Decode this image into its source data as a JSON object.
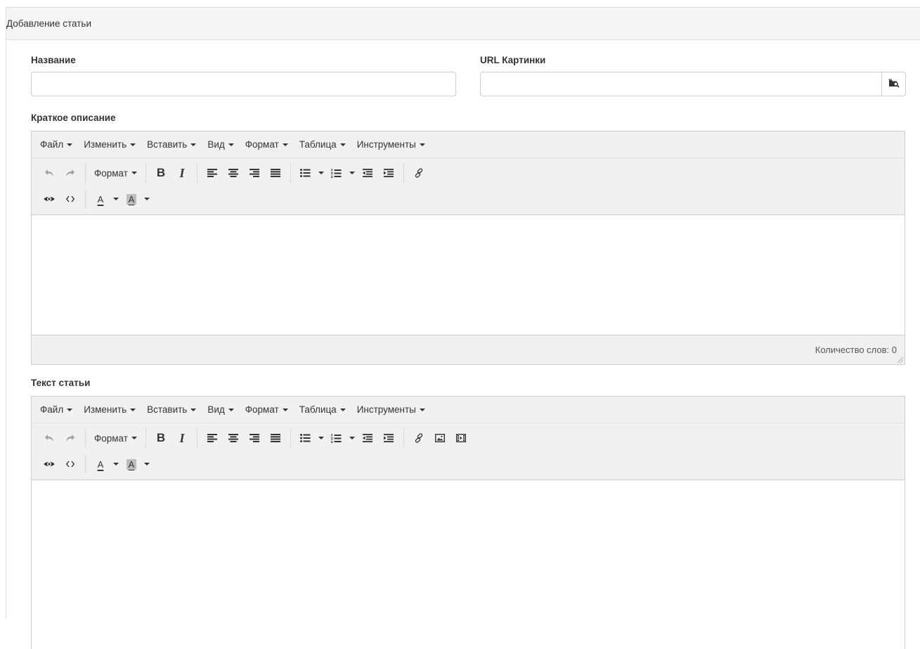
{
  "panel": {
    "title": "Добавление статьи"
  },
  "form": {
    "title_label": "Название",
    "title_value": "",
    "image_url_label": "URL Картинки",
    "image_url_value": "",
    "short_desc_label": "Краткое описание",
    "article_text_label": "Текст статьи"
  },
  "editor": {
    "menu": [
      "Файл",
      "Изменить",
      "Вставить",
      "Вид",
      "Формат",
      "Таблица",
      "Инструменты"
    ],
    "format_label": "Формат",
    "bold_glyph": "B",
    "italic_glyph": "I",
    "text_color_glyph": "A",
    "bg_color_glyph": "A",
    "status_text": "Количество слов: 0"
  },
  "icons": {
    "browse": "folder-search-icon",
    "undo": "undo-icon",
    "redo": "redo-icon",
    "align_left": "align-left-icon",
    "align_center": "align-center-icon",
    "align_right": "align-right-icon",
    "align_justify": "align-justify-icon",
    "bullet_list": "bullet-list-icon",
    "numbered_list": "numbered-list-icon",
    "outdent": "outdent-icon",
    "indent": "indent-icon",
    "link": "link-icon",
    "image": "image-icon",
    "media": "media-icon",
    "preview": "eye-icon",
    "code": "code-icon"
  },
  "colors": {
    "toolbar_bg": "#f0f0f0",
    "border": "#cccccc",
    "disabled_icon": "#a0a0a0"
  }
}
